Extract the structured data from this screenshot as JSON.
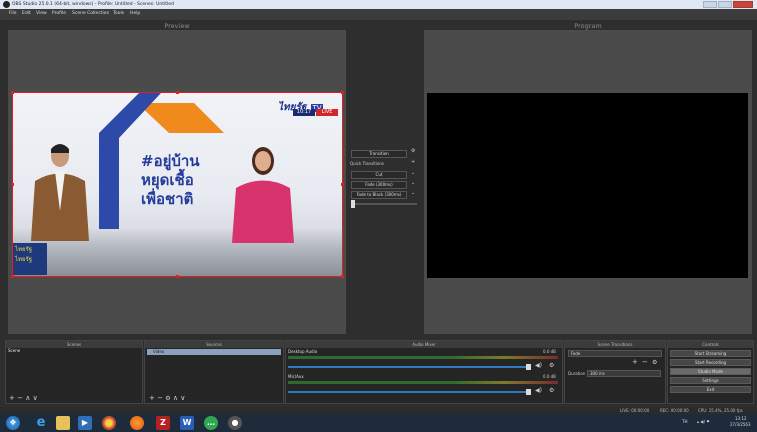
{
  "window": {
    "title": "OBS Studio 25.0.1 (64-bit, windows) - Profile: Untitled - Scenes: Untitled"
  },
  "menu": [
    "File",
    "Edit",
    "View",
    "Profile",
    "Scene Collection",
    "Tools",
    "Help"
  ],
  "preview": {
    "label": "Preview",
    "scene_text": {
      "hashtag": "#อยู่บ้าน",
      "line2": "หยุดเชื้อ",
      "line3": "เพื่อชาติ",
      "logo": "ไทยรัฐ",
      "logo_sub": "TV",
      "clock": "10:17",
      "badge": "LIVE",
      "corner1": "ไทยรัฐ",
      "corner2": "ไทยรัฐ"
    }
  },
  "program": {
    "label": "Program"
  },
  "transition": {
    "button": "Transition",
    "quick_label": "Quick Transitions",
    "items": [
      "Cut",
      "Fade (300ms)",
      "Fade to Black (300ms)"
    ]
  },
  "docks": {
    "scenes": {
      "title": "Scenes",
      "items": [
        "Scene"
      ]
    },
    "sources": {
      "title": "Sources",
      "items": [
        "Video"
      ]
    },
    "mixer": {
      "title": "Audio Mixer",
      "channels": [
        {
          "name": "Desktop Audio",
          "db": "0.0 dB"
        },
        {
          "name": "Mic/Aux",
          "db": "0.0 dB"
        }
      ]
    },
    "scene_transitions": {
      "title": "Scene Transitions",
      "selected": "Fade",
      "duration_label": "Duration",
      "duration_value": "300 ms"
    },
    "controls": {
      "title": "Controls",
      "buttons": [
        "Start Streaming",
        "Start Recording",
        "Studio Mode",
        "Settings",
        "Exit"
      ]
    }
  },
  "status": {
    "live": "LIVE: 00:00:00",
    "rec": "REC: 00:00:00",
    "cpu": "CPU: 15.4%, 25.00 fps"
  },
  "taskbar": {
    "lang": "TH",
    "time": "13:12",
    "date": "27/3/2563"
  },
  "colors": {
    "selection_red": "#e02020",
    "taskbar": "#1d2b3a",
    "accent_blue": "#2f7ac0"
  }
}
